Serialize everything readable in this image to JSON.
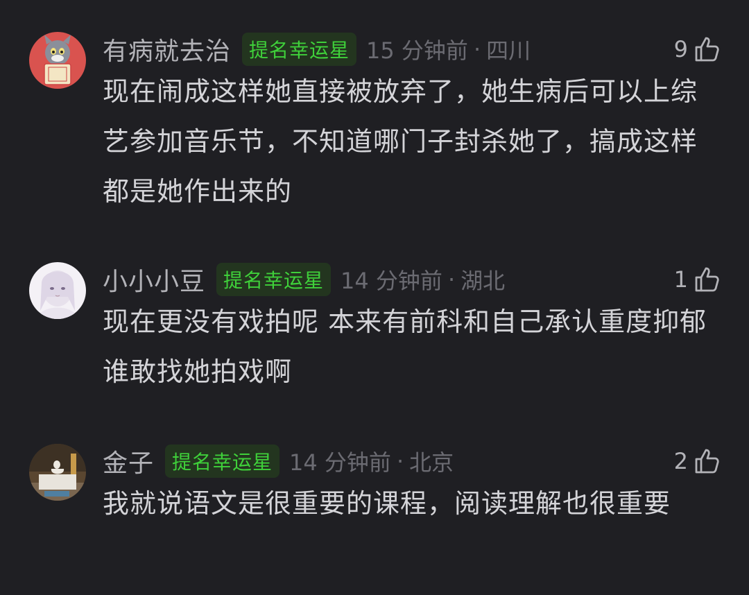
{
  "comments": [
    {
      "username": "有病就去治",
      "badge": "提名幸运星",
      "time": "15 分钟前",
      "location": "四川",
      "likes": "9",
      "text": "现在闹成这样她直接被放弃了，她生病后可以上综艺参加音乐节，不知道哪门子封杀她了，搞成这样都是她作出来的",
      "avatar_icon": "tom-cat-avatar"
    },
    {
      "username": "小小小豆",
      "badge": "提名幸运星",
      "time": "14 分钟前",
      "location": "湖北",
      "likes": "1",
      "text": "现在更没有戏拍呢 本来有前科和自己承认重度抑郁谁敢找她拍戏啊",
      "avatar_icon": "anime-girl-avatar"
    },
    {
      "username": "金子",
      "badge": "提名幸运星",
      "time": "14 分钟前",
      "location": "北京",
      "likes": "2",
      "text": "我就说语文是很重要的课程，阅读理解也很重要",
      "avatar_icon": "statue-avatar"
    }
  ],
  "separator": "·",
  "colors": {
    "background": "#1f1f23",
    "username": "#b3b3b8",
    "badge_text": "#3fd03a",
    "badge_bg": "#23351f",
    "meta": "#6b6b72",
    "body_text": "#d4d4d8"
  }
}
